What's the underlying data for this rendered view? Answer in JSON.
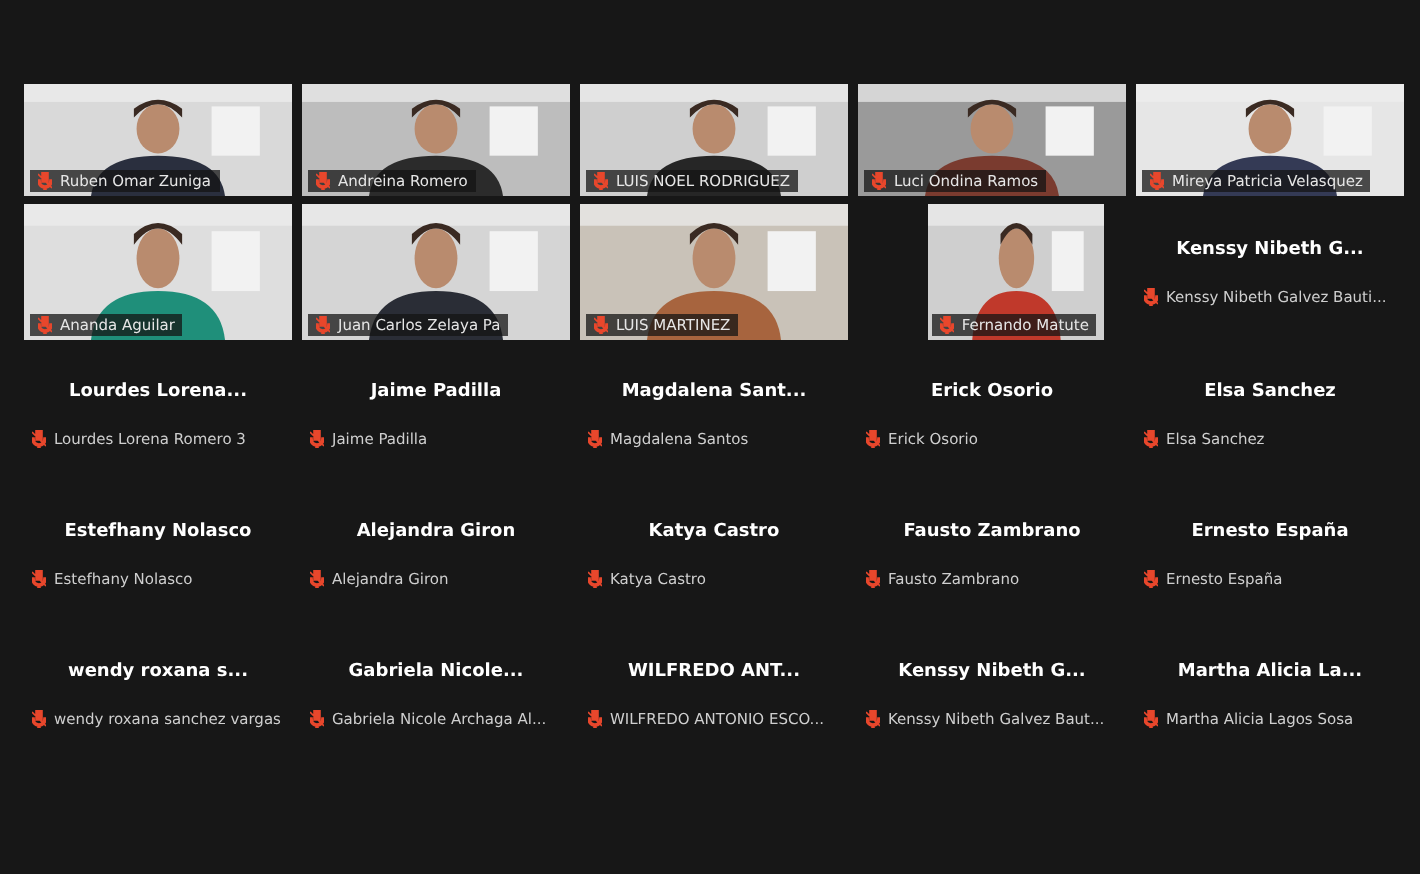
{
  "gallery": [
    {
      "kind": "video",
      "label": "Ruben Omar Zuniga"
    },
    {
      "kind": "video",
      "label": "Andreina Romero"
    },
    {
      "kind": "video",
      "label": "LUIS NOEL RODRIGUEZ"
    },
    {
      "kind": "video",
      "label": "Luci Ondina Ramos"
    },
    {
      "kind": "video",
      "label": "Mireya Patricia Velasquez"
    },
    {
      "kind": "video",
      "label": "Ananda Aguilar"
    },
    {
      "kind": "video",
      "label": "Juan Carlos Zelaya Pa"
    },
    {
      "kind": "video",
      "label": "LUIS MARTINEZ"
    },
    {
      "kind": "narrow",
      "label": "Fernando Matute"
    },
    {
      "kind": "name",
      "name": "Kenssy Nibeth G...",
      "label": "Kenssy Nibeth Galvez Bauti..."
    },
    {
      "kind": "name",
      "name": "Lourdes  Lorena...",
      "label": "Lourdes Lorena Romero 3"
    },
    {
      "kind": "name",
      "name": "Jaime Padilla",
      "label": "Jaime Padilla"
    },
    {
      "kind": "name",
      "name": "Magdalena  Sant...",
      "label": "Magdalena Santos"
    },
    {
      "kind": "name",
      "name": "Erick Osorio",
      "label": "Erick Osorio"
    },
    {
      "kind": "name",
      "name": "Elsa Sanchez",
      "label": "Elsa Sanchez"
    },
    {
      "kind": "name",
      "name": "Estefhany Nolasco",
      "label": "Estefhany Nolasco"
    },
    {
      "kind": "name",
      "name": "Alejandra Giron",
      "label": "Alejandra Giron"
    },
    {
      "kind": "name",
      "name": "Katya Castro",
      "label": "Katya Castro"
    },
    {
      "kind": "name",
      "name": "Fausto Zambrano",
      "label": "Fausto Zambrano"
    },
    {
      "kind": "name",
      "name": "Ernesto España",
      "label": "Ernesto España"
    },
    {
      "kind": "name",
      "name": "wendy roxana s...",
      "label": "wendy roxana sanchez vargas"
    },
    {
      "kind": "name",
      "name": "Gabriela  Nicole...",
      "label": "Gabriela Nicole Archaga Al..."
    },
    {
      "kind": "name",
      "name": "WILFREDO ANT...",
      "label": "WILFREDO ANTONIO ESCO..."
    },
    {
      "kind": "name",
      "name": "Kenssy Nibeth G...",
      "label": "Kenssy Nibeth Galvez Baut..."
    },
    {
      "kind": "name",
      "name": "Martha Alicia La...",
      "label": "Martha Alicia Lagos Sosa"
    }
  ]
}
